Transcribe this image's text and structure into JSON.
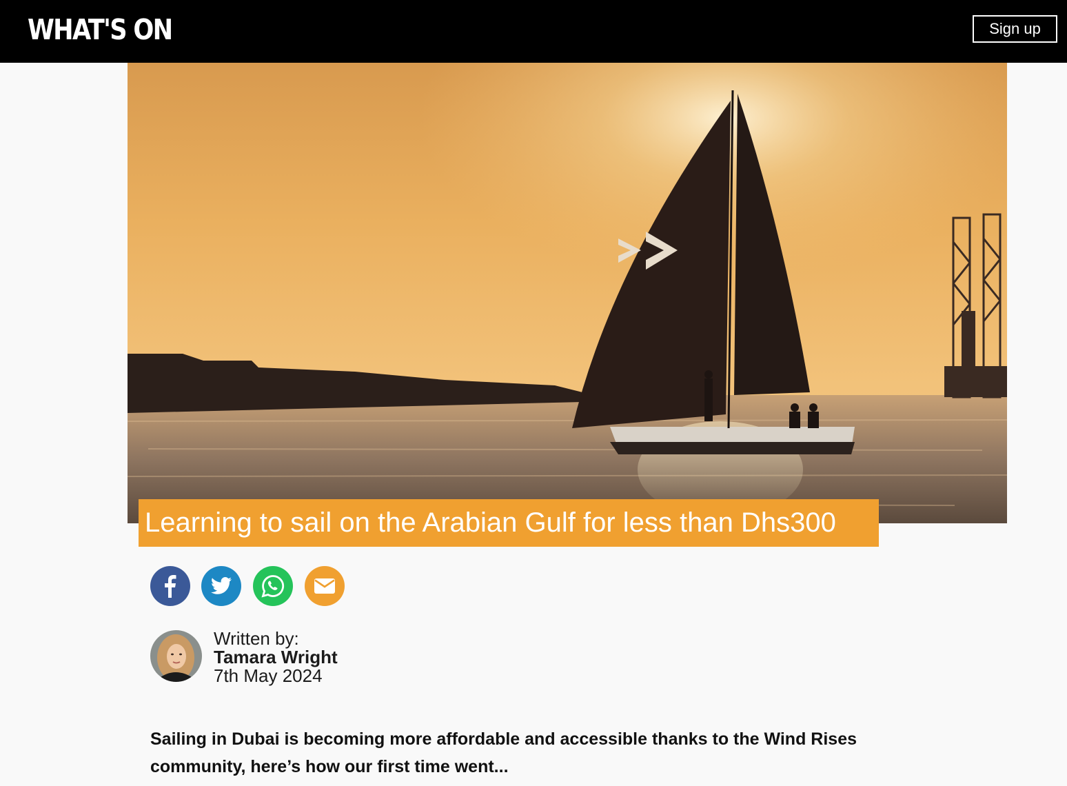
{
  "header": {
    "logo_text": "WHAT'S ON",
    "signup_label": "Sign up"
  },
  "article": {
    "title": "Learning to sail on the Arabian Gulf for less than Dhs300",
    "share_icons": [
      "facebook-icon",
      "twitter-icon",
      "whatsapp-icon",
      "email-icon"
    ],
    "author_label": "Written by:",
    "author_name": "Tamara Wright",
    "date": "7th May 2024",
    "intro": "Sailing in Dubai is becoming more affordable and accessible thanks to the Wind Rises community, here’s how our first time went..."
  },
  "colors": {
    "header_bg": "#000000",
    "headline_bg": "#f0a030",
    "facebook": "#3b5998",
    "twitter": "#1d88c4",
    "whatsapp": "#25c35a",
    "email": "#f0a030"
  }
}
